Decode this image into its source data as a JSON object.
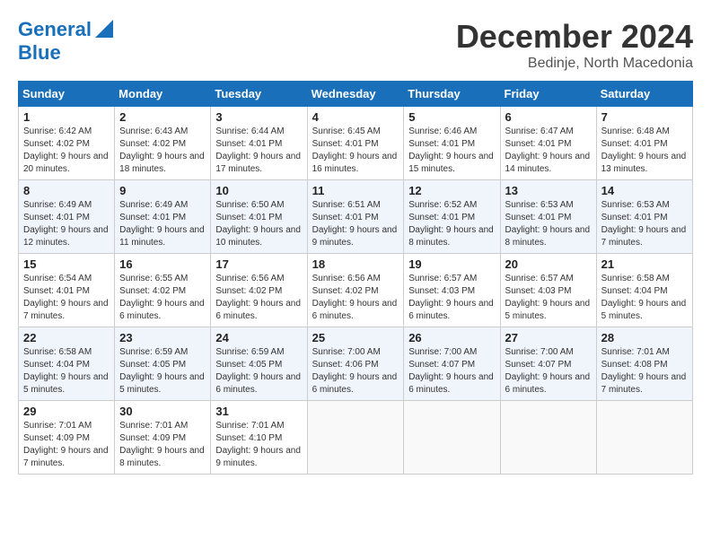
{
  "logo": {
    "line1": "General",
    "line2": "Blue"
  },
  "title": "December 2024",
  "location": "Bedinje, North Macedonia",
  "days_of_week": [
    "Sunday",
    "Monday",
    "Tuesday",
    "Wednesday",
    "Thursday",
    "Friday",
    "Saturday"
  ],
  "weeks": [
    [
      {
        "day": "1",
        "sunrise": "6:42 AM",
        "sunset": "4:02 PM",
        "daylight": "9 hours and 20 minutes."
      },
      {
        "day": "2",
        "sunrise": "6:43 AM",
        "sunset": "4:02 PM",
        "daylight": "9 hours and 18 minutes."
      },
      {
        "day": "3",
        "sunrise": "6:44 AM",
        "sunset": "4:01 PM",
        "daylight": "9 hours and 17 minutes."
      },
      {
        "day": "4",
        "sunrise": "6:45 AM",
        "sunset": "4:01 PM",
        "daylight": "9 hours and 16 minutes."
      },
      {
        "day": "5",
        "sunrise": "6:46 AM",
        "sunset": "4:01 PM",
        "daylight": "9 hours and 15 minutes."
      },
      {
        "day": "6",
        "sunrise": "6:47 AM",
        "sunset": "4:01 PM",
        "daylight": "9 hours and 14 minutes."
      },
      {
        "day": "7",
        "sunrise": "6:48 AM",
        "sunset": "4:01 PM",
        "daylight": "9 hours and 13 minutes."
      }
    ],
    [
      {
        "day": "8",
        "sunrise": "6:49 AM",
        "sunset": "4:01 PM",
        "daylight": "9 hours and 12 minutes."
      },
      {
        "day": "9",
        "sunrise": "6:49 AM",
        "sunset": "4:01 PM",
        "daylight": "9 hours and 11 minutes."
      },
      {
        "day": "10",
        "sunrise": "6:50 AM",
        "sunset": "4:01 PM",
        "daylight": "9 hours and 10 minutes."
      },
      {
        "day": "11",
        "sunrise": "6:51 AM",
        "sunset": "4:01 PM",
        "daylight": "9 hours and 9 minutes."
      },
      {
        "day": "12",
        "sunrise": "6:52 AM",
        "sunset": "4:01 PM",
        "daylight": "9 hours and 8 minutes."
      },
      {
        "day": "13",
        "sunrise": "6:53 AM",
        "sunset": "4:01 PM",
        "daylight": "9 hours and 8 minutes."
      },
      {
        "day": "14",
        "sunrise": "6:53 AM",
        "sunset": "4:01 PM",
        "daylight": "9 hours and 7 minutes."
      }
    ],
    [
      {
        "day": "15",
        "sunrise": "6:54 AM",
        "sunset": "4:01 PM",
        "daylight": "9 hours and 7 minutes."
      },
      {
        "day": "16",
        "sunrise": "6:55 AM",
        "sunset": "4:02 PM",
        "daylight": "9 hours and 6 minutes."
      },
      {
        "day": "17",
        "sunrise": "6:56 AM",
        "sunset": "4:02 PM",
        "daylight": "9 hours and 6 minutes."
      },
      {
        "day": "18",
        "sunrise": "6:56 AM",
        "sunset": "4:02 PM",
        "daylight": "9 hours and 6 minutes."
      },
      {
        "day": "19",
        "sunrise": "6:57 AM",
        "sunset": "4:03 PM",
        "daylight": "9 hours and 6 minutes."
      },
      {
        "day": "20",
        "sunrise": "6:57 AM",
        "sunset": "4:03 PM",
        "daylight": "9 hours and 5 minutes."
      },
      {
        "day": "21",
        "sunrise": "6:58 AM",
        "sunset": "4:04 PM",
        "daylight": "9 hours and 5 minutes."
      }
    ],
    [
      {
        "day": "22",
        "sunrise": "6:58 AM",
        "sunset": "4:04 PM",
        "daylight": "9 hours and 5 minutes."
      },
      {
        "day": "23",
        "sunrise": "6:59 AM",
        "sunset": "4:05 PM",
        "daylight": "9 hours and 5 minutes."
      },
      {
        "day": "24",
        "sunrise": "6:59 AM",
        "sunset": "4:05 PM",
        "daylight": "9 hours and 6 minutes."
      },
      {
        "day": "25",
        "sunrise": "7:00 AM",
        "sunset": "4:06 PM",
        "daylight": "9 hours and 6 minutes."
      },
      {
        "day": "26",
        "sunrise": "7:00 AM",
        "sunset": "4:07 PM",
        "daylight": "9 hours and 6 minutes."
      },
      {
        "day": "27",
        "sunrise": "7:00 AM",
        "sunset": "4:07 PM",
        "daylight": "9 hours and 6 minutes."
      },
      {
        "day": "28",
        "sunrise": "7:01 AM",
        "sunset": "4:08 PM",
        "daylight": "9 hours and 7 minutes."
      }
    ],
    [
      {
        "day": "29",
        "sunrise": "7:01 AM",
        "sunset": "4:09 PM",
        "daylight": "9 hours and 7 minutes."
      },
      {
        "day": "30",
        "sunrise": "7:01 AM",
        "sunset": "4:09 PM",
        "daylight": "9 hours and 8 minutes."
      },
      {
        "day": "31",
        "sunrise": "7:01 AM",
        "sunset": "4:10 PM",
        "daylight": "9 hours and 9 minutes."
      },
      null,
      null,
      null,
      null
    ]
  ]
}
